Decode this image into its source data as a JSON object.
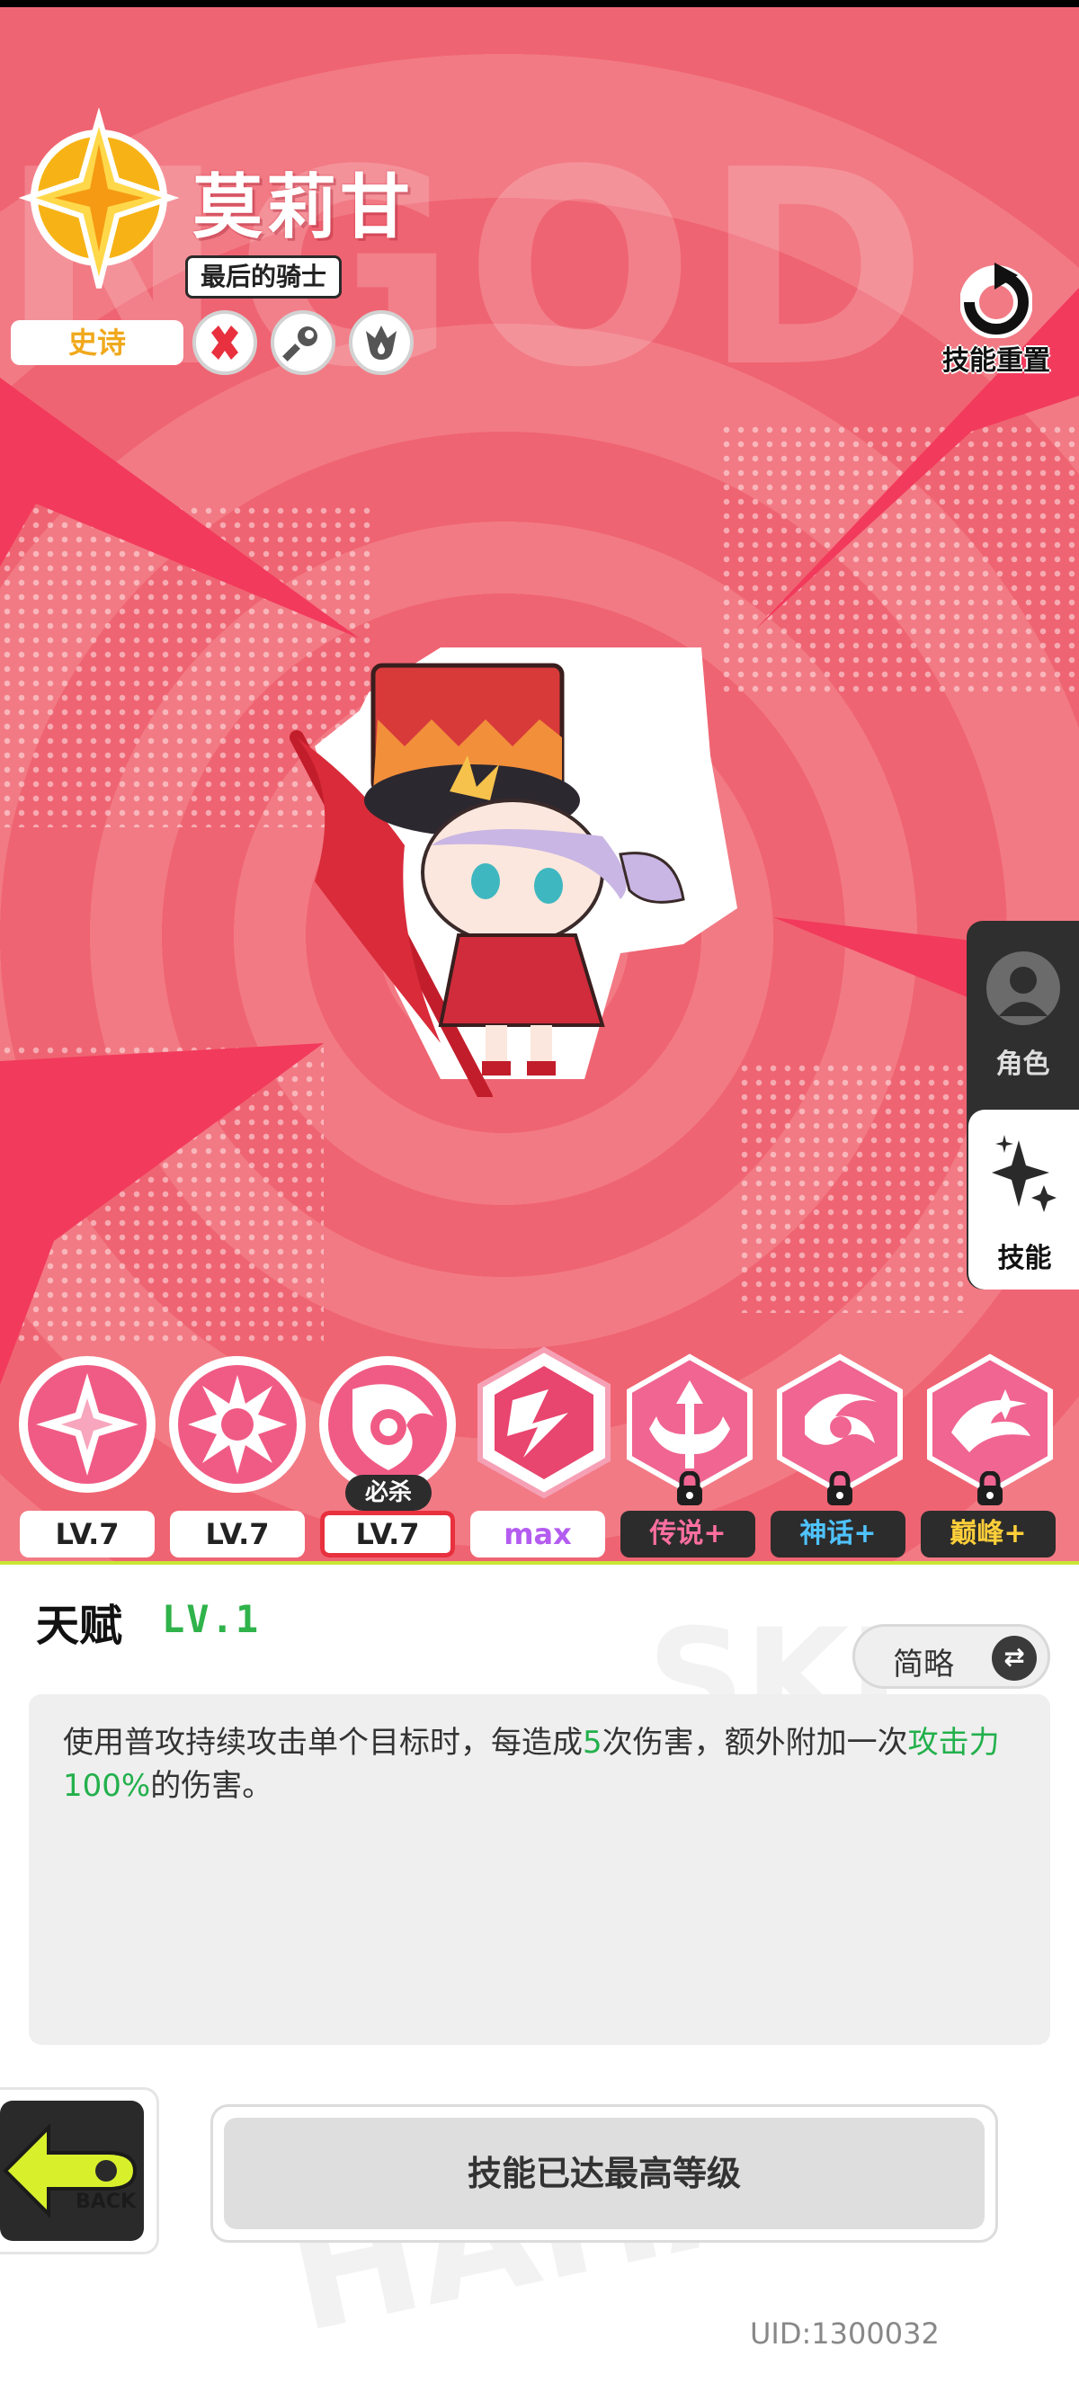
{
  "character": {
    "name": "莫莉甘",
    "title": "最后的骑士",
    "rarity": "史诗",
    "traits": [
      "x-trait-icon",
      "wrench-trait-icon",
      "flame-trait-icon"
    ]
  },
  "header": {
    "reset_label": "技能重置",
    "background_text": "NGOD"
  },
  "side_tabs": [
    {
      "label": "角色",
      "icon": "avatar-icon",
      "active": false
    },
    {
      "label": "技能",
      "icon": "sparkle-icon",
      "active": true
    }
  ],
  "skills": [
    {
      "level": "LV.7",
      "icon": "skill-star-burst-icon",
      "locked": false
    },
    {
      "level": "LV.7",
      "icon": "skill-explosion-icon",
      "locked": false
    },
    {
      "level": "LV.7",
      "icon": "skill-shield-strike-icon",
      "locked": false,
      "tag": "必杀"
    },
    {
      "level": "max",
      "icon": "skill-talent-icon",
      "locked": false,
      "selected": true
    },
    {
      "level": "传说+",
      "icon": "skill-legend-icon",
      "locked": true
    },
    {
      "level": "神话+",
      "icon": "skill-myth-icon",
      "locked": true
    },
    {
      "level": "巅峰+",
      "icon": "skill-peak-icon",
      "locked": true
    }
  ],
  "talent": {
    "title": "天赋",
    "level": "LV.1",
    "toggle_label": "简略",
    "desc_before": "使用普攻持续攻击单个目标时，每造成",
    "desc_num": "5",
    "desc_mid": "次伤害，额外附加一次",
    "desc_hl": "攻击力100%",
    "desc_after": "的伤害。"
  },
  "footer": {
    "back_label": "BACK",
    "max_label": "技能已达最高等级",
    "uid": "UID:1300032"
  },
  "colors": {
    "accent": "#ef6472",
    "highlight": "#23b04c",
    "rarity": "#f0a91c",
    "slime": "#c8e635"
  }
}
